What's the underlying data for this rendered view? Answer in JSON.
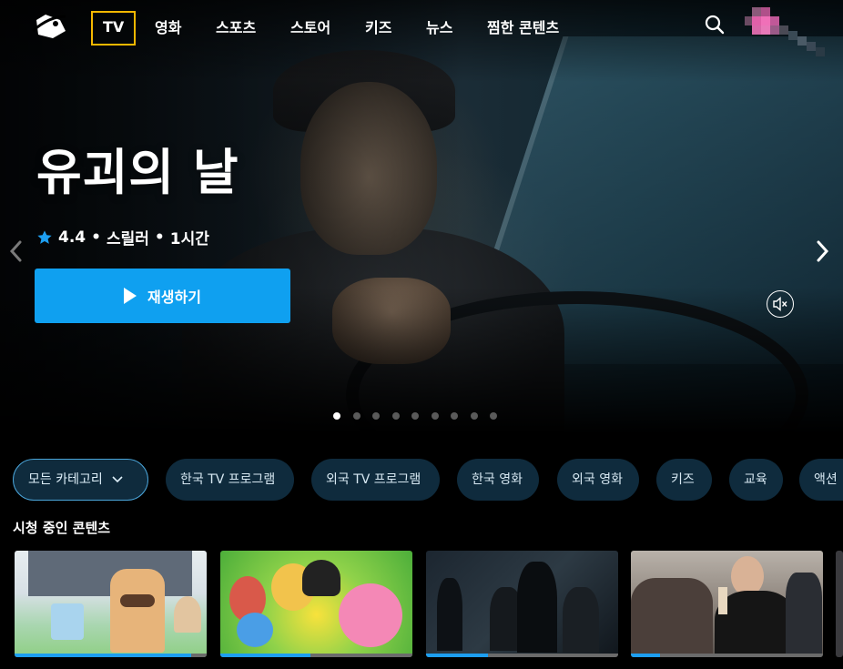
{
  "nav": {
    "logo": "app-logo",
    "items": [
      "TV",
      "영화",
      "스포츠",
      "스토어",
      "키즈",
      "뉴스",
      "찜한 콘텐츠"
    ],
    "active_item": "TV"
  },
  "hero": {
    "title": "유괴의 날",
    "rating": "4.4",
    "genre": "스릴러",
    "duration": "1시간",
    "play_label": "재생하기",
    "page_count": 9,
    "current_page": 1
  },
  "categories": [
    "모든 카테고리",
    "한국 TV 프로그램",
    "외국 TV 프로그램",
    "한국 영화",
    "외국 영화",
    "키즈",
    "교육",
    "액션"
  ],
  "continue_watching": {
    "title": "시청 중인 콘텐츠",
    "items": [
      {
        "thumb": "animated bread character",
        "progress": 0.92
      },
      {
        "thumb": "pinkfong and friends",
        "progress": 0.47
      },
      {
        "thumb": "dark crime drama scene",
        "progress": 0.32
      },
      {
        "thumb": "woman holding wine glass",
        "progress": 0.15
      }
    ]
  },
  "colors": {
    "accent": "#0fa0f0",
    "active_nav_border": "#f5b800",
    "chip_bg": "#0f2b3d",
    "progress": "#1d9ef0"
  }
}
